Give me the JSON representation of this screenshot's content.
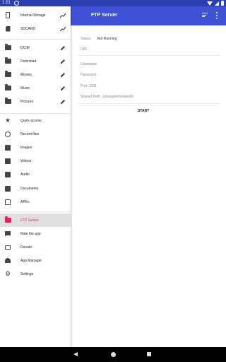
{
  "status_bar": {
    "time": "1:21"
  },
  "drawer": {
    "storage": [
      {
        "label": "Internal Storage",
        "icon": "phone-icon",
        "trail": "chart-icon"
      },
      {
        "label": "SDCARD",
        "icon": "sd-card-icon",
        "trail": "chart-icon"
      }
    ],
    "folders": [
      {
        "label": "DCIM",
        "icon": "folder-icon",
        "trail": "edit-icon"
      },
      {
        "label": "Download",
        "icon": "folder-icon",
        "trail": "edit-icon"
      },
      {
        "label": "Movies",
        "icon": "folder-icon",
        "trail": "edit-icon"
      },
      {
        "label": "Music",
        "icon": "folder-icon",
        "trail": "edit-icon"
      },
      {
        "label": "Pictures",
        "icon": "folder-icon",
        "trail": "edit-icon"
      }
    ],
    "quick": [
      {
        "label": "Quick access",
        "icon": "star-icon"
      },
      {
        "label": "Recent files",
        "icon": "history-icon"
      },
      {
        "label": "Images",
        "icon": "image-icon"
      },
      {
        "label": "Videos",
        "icon": "video-icon"
      },
      {
        "label": "Audio",
        "icon": "audio-icon"
      },
      {
        "label": "Documents",
        "icon": "document-icon"
      },
      {
        "label": "APKs",
        "icon": "apk-icon"
      }
    ],
    "tools": [
      {
        "label": "FTP Server",
        "icon": "ftp-folder-icon",
        "active": true
      },
      {
        "label": "Rate the app",
        "icon": "rate-icon"
      },
      {
        "label": "Donate",
        "icon": "credit-card-icon"
      },
      {
        "label": "App Manager",
        "icon": "android-icon"
      },
      {
        "label": "Settings",
        "icon": "gear-icon"
      }
    ]
  },
  "appbar": {
    "title": "FTP Server"
  },
  "ftp": {
    "status_label": "Status:",
    "status_value": "Not Running",
    "url_label": "URL:",
    "username_label": "Username:",
    "password_label": "Password:",
    "port_label": "Port: 2201",
    "shared_path_label": "Shared Path: /storage/emulated/0",
    "start_label": "START"
  },
  "colors": {
    "primary": "#3f51d5",
    "status_bar": "#2b3fb0",
    "accent": "#e91e63"
  }
}
